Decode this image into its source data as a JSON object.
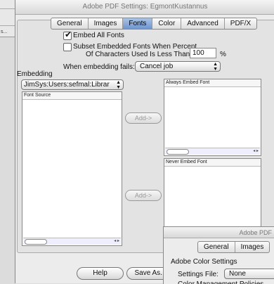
{
  "background_window": {
    "label": "s..."
  },
  "window": {
    "title": "Adobe PDF Settings: EgmontKustannus"
  },
  "tabs": [
    {
      "label": "General",
      "selected": false
    },
    {
      "label": "Images",
      "selected": false
    },
    {
      "label": "Fonts",
      "selected": true
    },
    {
      "label": "Color",
      "selected": false
    },
    {
      "label": "Advanced",
      "selected": false
    },
    {
      "label": "PDF/X",
      "selected": false
    }
  ],
  "fonts": {
    "embed_all_label": "Embed All Fonts",
    "embed_all_checked": true,
    "subset_label_1": "Subset Embedded Fonts When Percent",
    "subset_label_2": "Of Characters Used Is Less Than:",
    "subset_checked": false,
    "subset_value": "100",
    "percent": "%",
    "fail_label": "When embedding fails:",
    "fail_value": "Cancel job",
    "embedding_label": "Embedding",
    "source_popup": "JimSys:Users:sefmal:Librar",
    "font_source_header": "Font Source",
    "always_header": "Always Embed Font",
    "never_header": "Never Embed Font",
    "add_label_1": "Add->",
    "add_label_2": "Add->"
  },
  "footer": {
    "help_label": "Help",
    "save_as_label": "Save As..."
  },
  "window2": {
    "title": "Adobe PDF",
    "tab_general": "General",
    "tab_images": "Images",
    "section": "Adobe Color Settings",
    "settings_label": "Settings File:",
    "settings_value": "None",
    "policies_label": "Color Management Policies"
  },
  "colors": {
    "selected_tab": "#6e95cf",
    "window_bg": "#ececec"
  }
}
